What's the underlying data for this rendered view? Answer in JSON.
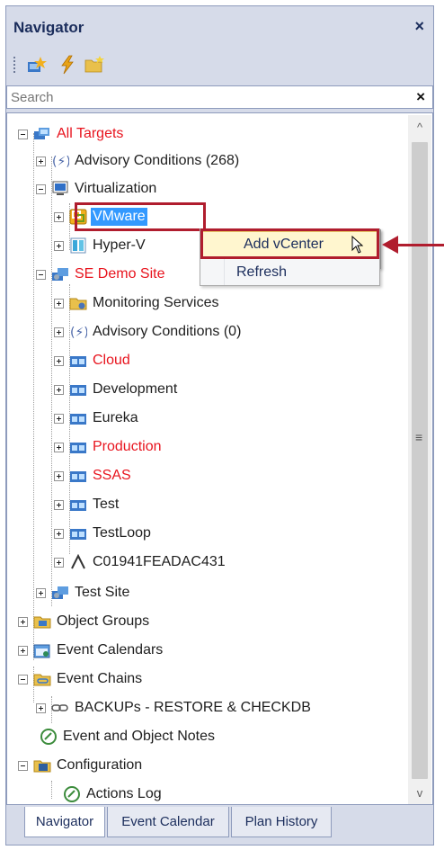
{
  "panel": {
    "title": "Navigator",
    "close": "×"
  },
  "search": {
    "placeholder": "Search",
    "clear": "×"
  },
  "tree": {
    "all_targets": "All Targets",
    "advisory_1": "Advisory Conditions (268)",
    "virtualization": "Virtualization",
    "vmware": "VMware",
    "hyperv": "Hyper-V",
    "se_demo_site": "SE Demo Site",
    "monitoring_services": "Monitoring Services",
    "advisory_2": "Advisory Conditions (0)",
    "cloud": "Cloud",
    "development": "Development",
    "eureka": "Eureka",
    "production": "Production",
    "ssas": "SSAS",
    "test": "Test",
    "testloop": "TestLoop",
    "c0194": "C01941FEADAC431",
    "test_site": "Test Site",
    "object_groups": "Object Groups",
    "event_calendars": "Event Calendars",
    "event_chains": "Event Chains",
    "backups": "BACKUPs - RESTORE & CHECKDB",
    "event_object_notes": "Event and Object Notes",
    "configuration": "Configuration",
    "actions_log": "Actions Log"
  },
  "context_menu": {
    "add_vcenter": "Add vCenter",
    "refresh": "Refresh"
  },
  "tabs": {
    "navigator": "Navigator",
    "event_calendar": "Event Calendar",
    "plan_history": "Plan History"
  },
  "colors": {
    "accent_red": "#b01d2e",
    "selection": "#3399ff",
    "red_text": "#e8141e"
  }
}
